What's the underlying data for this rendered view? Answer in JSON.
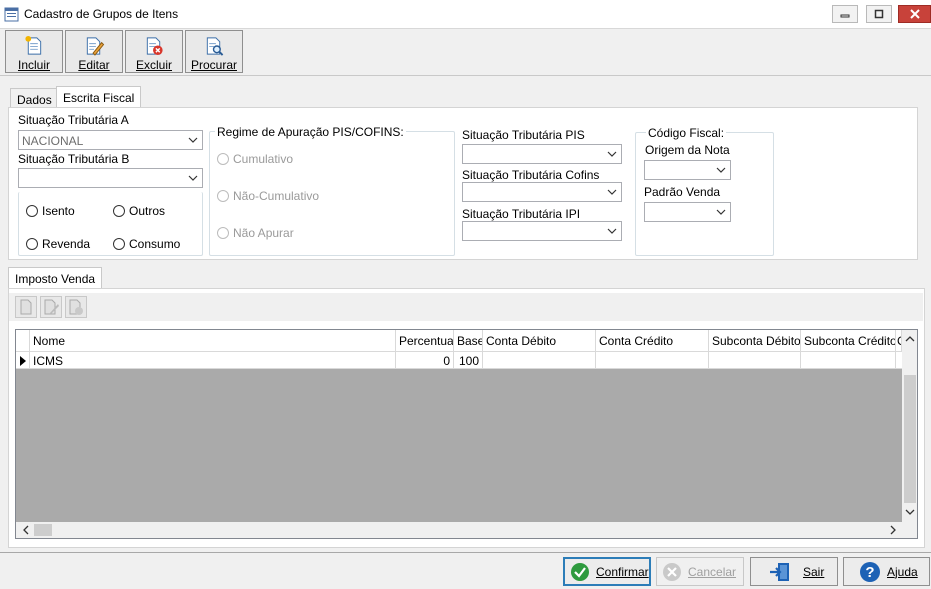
{
  "window": {
    "title": "Cadastro de Grupos de Itens",
    "controls": [
      "minimize",
      "maximize",
      "close"
    ]
  },
  "toolbar": {
    "buttons": [
      {
        "label": "Incluir",
        "icon": "new-document-icon"
      },
      {
        "label": "Editar",
        "icon": "edit-document-icon"
      },
      {
        "label": "Excluir",
        "icon": "delete-document-icon"
      },
      {
        "label": "Procurar",
        "icon": "search-document-icon"
      }
    ]
  },
  "tabs": {
    "items": [
      "Dados",
      "Escrita Fiscal"
    ],
    "active": "Escrita Fiscal"
  },
  "fiscal": {
    "sit_a_label": "Situação Tributária A",
    "sit_a_value": "NACIONAL",
    "sit_b_label": "Situação Tributária B",
    "sit_b_value": "",
    "radios": [
      "Isento",
      "Outros",
      "Revenda",
      "Consumo"
    ],
    "regime": {
      "title": "Regime de Apuração PIS/COFINS:",
      "options": [
        "Cumulativo",
        "Não-Cumulativo",
        "Não Apurar"
      ]
    },
    "pis_label": "Situação Tributária PIS",
    "cofins_label": "Situação Tributária Cofins",
    "ipi_label": "Situação Tributária IPI",
    "codigo": {
      "title": "Código Fiscal:",
      "origem_label": "Origem da Nota",
      "padrao_label": "Padrão Venda"
    }
  },
  "imposto_tab": "Imposto Venda",
  "grid": {
    "columns": [
      "Nome",
      "Percentual",
      "Base",
      "Conta Débito",
      "Conta Crédito",
      "Subconta Débito",
      "Subconta Crédito",
      "C"
    ],
    "rows": [
      {
        "nome": "ICMS",
        "percentual": "0",
        "base": "100",
        "conta_debito": "",
        "conta_credito": "",
        "subconta_debito": "",
        "subconta_credito": ""
      }
    ]
  },
  "footer": {
    "confirmar": "Confirmar",
    "cancelar": "Cancelar",
    "sair": "Sair",
    "ajuda": "Ajuda"
  },
  "colors": {
    "accent": "#2c7db8",
    "confirm_green": "#2e9a3e",
    "close_red": "#c8423a",
    "help_blue": "#1d62b5"
  }
}
